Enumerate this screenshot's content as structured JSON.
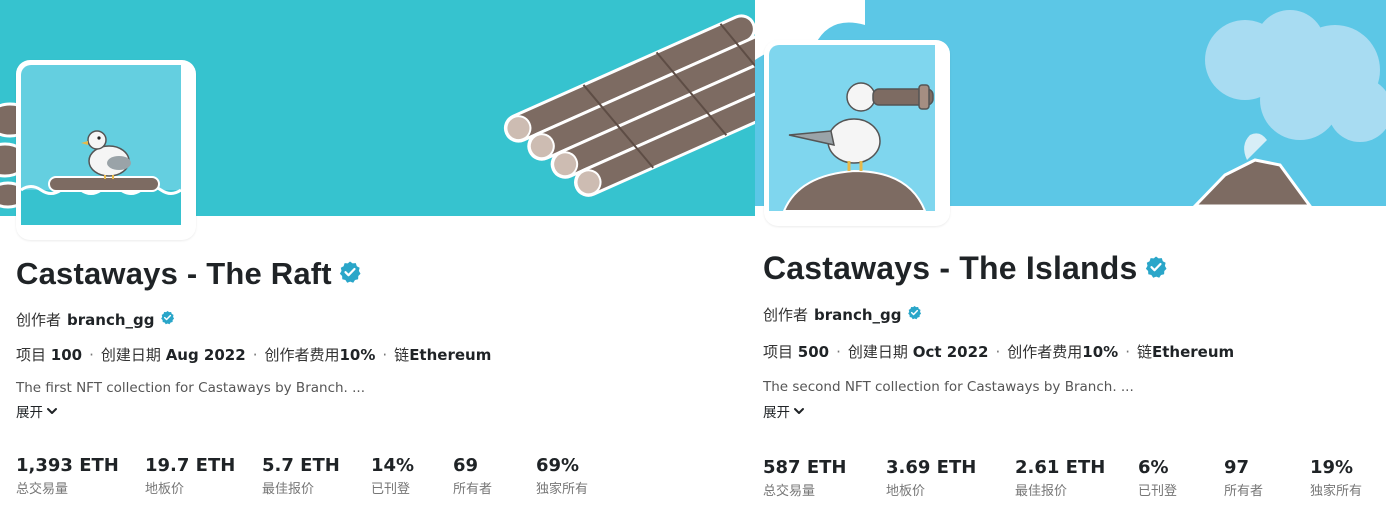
{
  "left": {
    "title": "Castaways - The Raft",
    "creator_prefix": "创作者",
    "creator_name": "branch_gg",
    "meta": {
      "items_label": "项目",
      "items_value": "100",
      "created_label": "创建日期",
      "created_value": "Aug 2022",
      "fee_label": "创作者费用",
      "fee_value": "10%",
      "chain_label": "链",
      "chain_value": "Ethereum",
      "dot": "·"
    },
    "description": "The first NFT collection for Castaways by Branch. ...",
    "expand_label": "展开",
    "stats": [
      {
        "value": "1,393 ETH",
        "label": "总交易量"
      },
      {
        "value": "19.7 ETH",
        "label": "地板价"
      },
      {
        "value": "5.7 ETH",
        "label": "最佳报价"
      },
      {
        "value": "14%",
        "label": "已刊登"
      },
      {
        "value": "69",
        "label": "所有者"
      },
      {
        "value": "69%",
        "label": "独家所有"
      }
    ]
  },
  "right": {
    "title": "Castaways - The Islands",
    "creator_prefix": "创作者",
    "creator_name": "branch_gg",
    "meta": {
      "items_label": "项目",
      "items_value": "500",
      "created_label": "创建日期",
      "created_value": "Oct 2022",
      "fee_label": "创作者费用",
      "fee_value": "10%",
      "chain_label": "链",
      "chain_value": "Ethereum",
      "dot": "·"
    },
    "description": "The second NFT collection for Castaways by Branch. ...",
    "expand_label": "展开",
    "stats": [
      {
        "value": "587 ETH",
        "label": "总交易量"
      },
      {
        "value": "3.69 ETH",
        "label": "地板价"
      },
      {
        "value": "2.61 ETH",
        "label": "最佳报价"
      },
      {
        "value": "6%",
        "label": "已刊登"
      },
      {
        "value": "97",
        "label": "所有者"
      },
      {
        "value": "19%",
        "label": "独家所有"
      }
    ]
  },
  "icons": {
    "verified": "verified-badge-icon",
    "chevron": "chevron-down-icon"
  },
  "colors": {
    "raft_banner": "#36c3cf",
    "islands_banner": "#5cc7e6",
    "verified_blue": "#2081e2"
  }
}
